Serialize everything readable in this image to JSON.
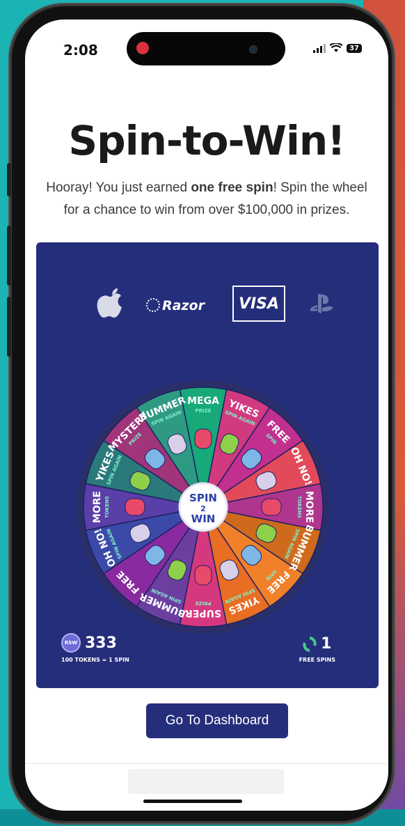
{
  "status_bar": {
    "time": "2:08",
    "battery": "37"
  },
  "header": {
    "title": "Spin-to-Win!",
    "desc_prefix": "Hooray! You just earned ",
    "desc_bold": "one free spin",
    "desc_suffix": "! Spin the wheel for a chance to win from over $100,000 in prizes."
  },
  "brands": {
    "razor": "Razor",
    "visa": "VISA"
  },
  "wheel": {
    "center_line1": "SPIN",
    "center_line2": "2",
    "center_line3": "WIN",
    "segments": [
      {
        "label": "MEGA",
        "sub": "PRIZE",
        "color": "#17a97a"
      },
      {
        "label": "YIKES",
        "sub": "SPIN AGAIN",
        "color": "#d13a7e"
      },
      {
        "label": "FREE",
        "sub": "SPIN",
        "color": "#c12f8f"
      },
      {
        "label": "OH NO!",
        "sub": "",
        "color": "#e24a5a"
      },
      {
        "label": "MORE",
        "sub": "TOKENS",
        "color": "#b0358f"
      },
      {
        "label": "BUMMER",
        "sub": "SPIN AGAIN",
        "color": "#cf6a1d"
      },
      {
        "label": "FREE",
        "sub": "SPIN",
        "color": "#f0802a"
      },
      {
        "label": "YIKES",
        "sub": "SPIN AGAIN",
        "color": "#e96d22"
      },
      {
        "label": "SUPER",
        "sub": "PRIZE",
        "color": "#d6387f"
      },
      {
        "label": "BUMMER",
        "sub": "SPIN AGAIN",
        "color": "#6b3ea0"
      },
      {
        "label": "FREE",
        "sub": "",
        "color": "#8a2aa0"
      },
      {
        "label": "OH NO!",
        "sub": "SPIN AGAIN",
        "color": "#3b4aa8"
      },
      {
        "label": "MORE",
        "sub": "TOKENS",
        "color": "#5a3fa8"
      },
      {
        "label": "YIKES",
        "sub": "SPIN AGAIN",
        "color": "#2a7a7c"
      },
      {
        "label": "MYSTERY",
        "sub": "PRIZE",
        "color": "#a0357a"
      },
      {
        "label": "BUMMER",
        "sub": "SPIN AGAIN",
        "color": "#2f9a84"
      }
    ]
  },
  "tokens": {
    "count": "333",
    "subtitle": "100 TOKENS = 1 SPIN"
  },
  "free_spins": {
    "count": "1",
    "subtitle": "FREE SPINS"
  },
  "actions": {
    "dashboard_label": "Go To Dashboard"
  }
}
